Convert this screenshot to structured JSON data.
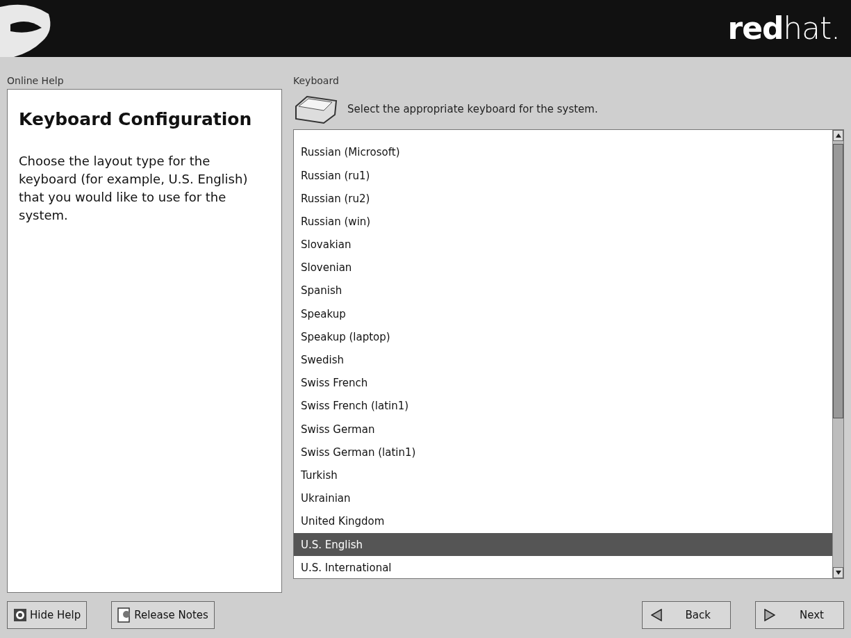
{
  "header": {
    "logo": {
      "bold": "red",
      "light": "hat."
    }
  },
  "help_panel": {
    "label": "Online Help",
    "title": "Keyboard Configuration",
    "body": "Choose the layout type for the keyboard (for example, U.S. English) that you would like to use for the system."
  },
  "keyboard_panel": {
    "label": "Keyboard",
    "instruction": "Select the appropriate keyboard for the system.",
    "layouts": [
      {
        "name": "Russian (Microsoft)",
        "selected": false
      },
      {
        "name": "Russian (ru1)",
        "selected": false
      },
      {
        "name": "Russian (ru2)",
        "selected": false
      },
      {
        "name": "Russian (win)",
        "selected": false
      },
      {
        "name": "Slovakian",
        "selected": false
      },
      {
        "name": "Slovenian",
        "selected": false
      },
      {
        "name": "Spanish",
        "selected": false
      },
      {
        "name": "Speakup",
        "selected": false
      },
      {
        "name": "Speakup (laptop)",
        "selected": false
      },
      {
        "name": "Swedish",
        "selected": false
      },
      {
        "name": "Swiss French",
        "selected": false
      },
      {
        "name": "Swiss French (latin1)",
        "selected": false
      },
      {
        "name": "Swiss German",
        "selected": false
      },
      {
        "name": "Swiss German (latin1)",
        "selected": false
      },
      {
        "name": "Turkish",
        "selected": false
      },
      {
        "name": "Ukrainian",
        "selected": false
      },
      {
        "name": "United Kingdom",
        "selected": false
      },
      {
        "name": "U.S. English",
        "selected": true
      },
      {
        "name": "U.S. International",
        "selected": false
      }
    ]
  },
  "buttons": [
    {
      "kind": "help",
      "label": "Hide Help"
    },
    {
      "kind": "notes",
      "label": "Release Notes"
    },
    {
      "kind": "back",
      "label": "Back"
    },
    {
      "kind": "next",
      "label": "Next"
    }
  ]
}
